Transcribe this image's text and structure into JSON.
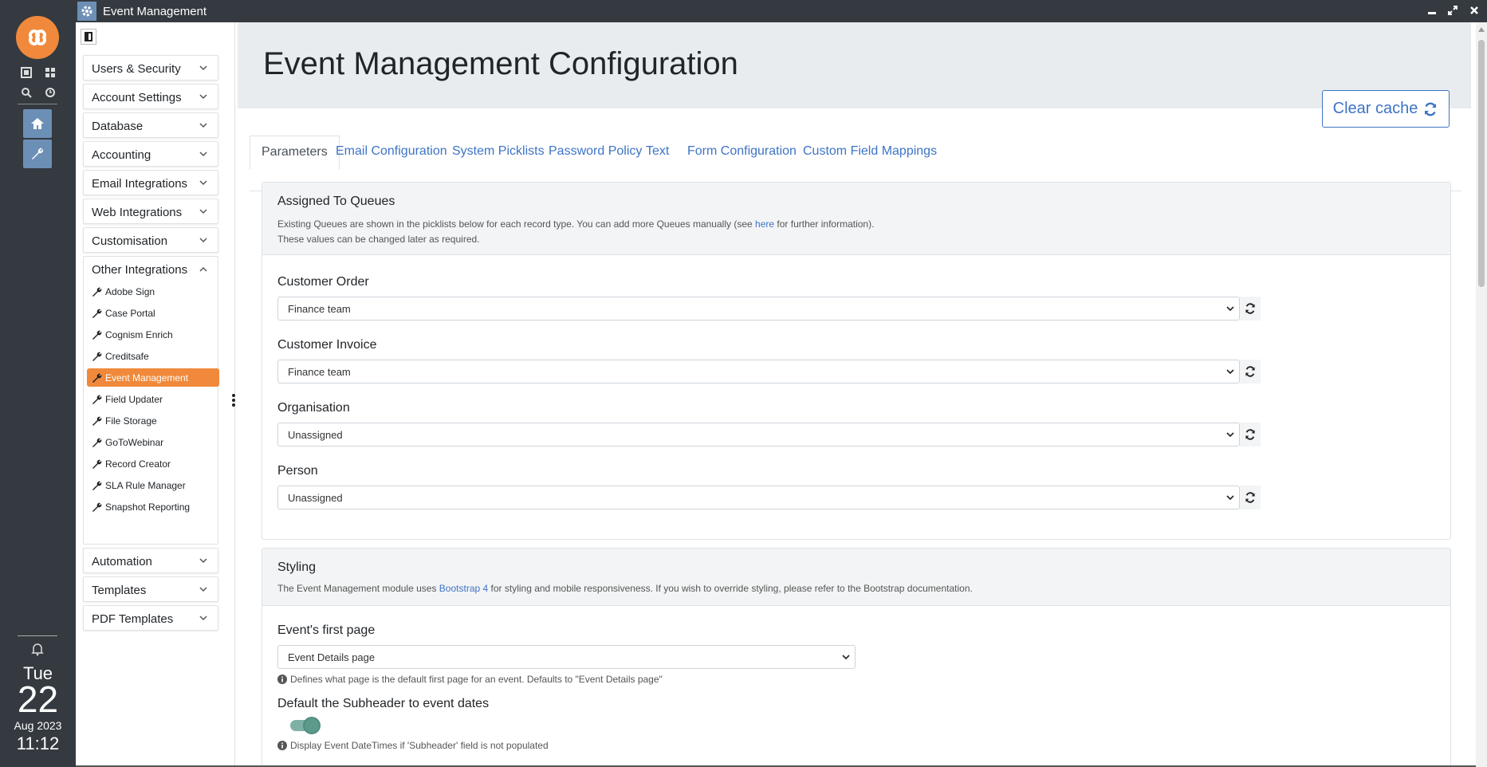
{
  "window": {
    "title": "Event Management"
  },
  "rail": {
    "day_name": "Tue",
    "day_number": "22",
    "month_year": "Aug 2023",
    "time": "11:12"
  },
  "sidebar": {
    "items_top": [
      {
        "label": "Users & Security"
      },
      {
        "label": "Account Settings"
      },
      {
        "label": "Database"
      },
      {
        "label": "Accounting"
      },
      {
        "label": "Email Integrations"
      },
      {
        "label": "Web Integrations"
      },
      {
        "label": "Customisation"
      }
    ],
    "other_integrations": {
      "label": "Other Integrations",
      "items": [
        {
          "label": "Adobe Sign"
        },
        {
          "label": "Case Portal"
        },
        {
          "label": "Cognism Enrich"
        },
        {
          "label": "Creditsafe"
        },
        {
          "label": "Event Management"
        },
        {
          "label": "Field Updater"
        },
        {
          "label": "File Storage"
        },
        {
          "label": "GoToWebinar"
        },
        {
          "label": "Record Creator"
        },
        {
          "label": "SLA Rule Manager"
        },
        {
          "label": "Snapshot Reporting"
        }
      ],
      "active_index": 4
    },
    "items_bottom": [
      {
        "label": "Automation"
      },
      {
        "label": "Templates"
      },
      {
        "label": "PDF Templates"
      }
    ]
  },
  "main": {
    "title": "Event Management Configuration",
    "clear_cache_label": "Clear cache",
    "tabs": [
      {
        "label": "Parameters"
      },
      {
        "label": "Email Configuration"
      },
      {
        "label": "System Picklists"
      },
      {
        "label": "Password Policy"
      },
      {
        "label": "Text"
      },
      {
        "label": "Form Configuration"
      },
      {
        "label": "Custom Field Mappings"
      }
    ],
    "queues_card": {
      "title": "Assigned To Queues",
      "desc_line1_pre": "Existing Queues are shown in the picklists below for each record type. You can add more Queues manually (see",
      "desc_link": "here",
      "desc_line1_post": "for further information).",
      "desc_line2": "These values can be changed later as required.",
      "fields": [
        {
          "label": "Customer Order",
          "value": "Finance team"
        },
        {
          "label": "Customer Invoice",
          "value": "Finance team"
        },
        {
          "label": "Organisation",
          "value": "Unassigned"
        },
        {
          "label": "Person",
          "value": "Unassigned"
        }
      ]
    },
    "styling_card": {
      "title": "Styling",
      "desc_pre": "The Event Management module uses",
      "desc_link": "Bootstrap 4",
      "desc_post": "for styling and mobile responsiveness. If you wish to override styling, please refer to the Bootstrap documentation.",
      "first_page_label": "Event's first page",
      "first_page_value": "Event Details page",
      "first_page_hint": "Defines what page is the default first page for an event. Defaults to \"Event Details page\"",
      "subheader_label": "Default the Subheader to event dates",
      "subheader_enabled": true,
      "subheader_hint": "Display Event DateTimes if 'Subheader' field is not populated"
    }
  },
  "colors": {
    "accent": "#f0893b",
    "link": "#3d74c6",
    "rail": "#343a40",
    "rail_button": "#6c8fb6"
  }
}
